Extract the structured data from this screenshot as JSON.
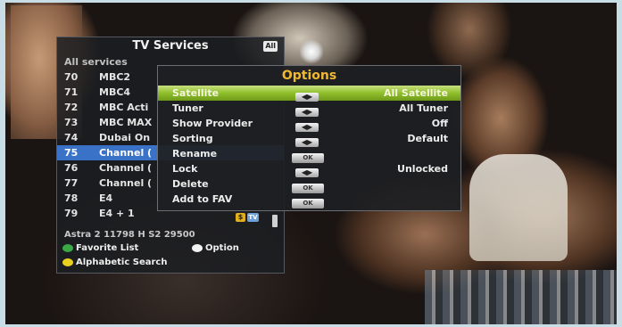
{
  "services": {
    "title": "TV Services",
    "all_badge": "All",
    "subtitle": "All services",
    "rows": [
      {
        "num": "70",
        "name": "MBC2"
      },
      {
        "num": "71",
        "name": "MBC4"
      },
      {
        "num": "72",
        "name": "MBC Acti"
      },
      {
        "num": "73",
        "name": "MBC MAX"
      },
      {
        "num": "74",
        "name": "Dubai On"
      },
      {
        "num": "75",
        "name": "Channel ("
      },
      {
        "num": "76",
        "name": "Channel ("
      },
      {
        "num": "77",
        "name": "Channel ("
      },
      {
        "num": "78",
        "name": "E4"
      },
      {
        "num": "79",
        "name": "E4 + 1"
      }
    ],
    "row_badges": {
      "s": "$",
      "tv": "TV"
    },
    "tp_info": "Astra 2 11798  H  S2 29500",
    "legend": {
      "green": "Favorite List",
      "white": "Option",
      "yellow": "Alphabetic Search"
    },
    "colors": {
      "selected": "#3a72c8",
      "green": "#3aa844",
      "yellow": "#e8d020"
    }
  },
  "options": {
    "title": "Options",
    "rows": [
      {
        "label": "Satellite",
        "control": "arrows",
        "value": "All Satellite"
      },
      {
        "label": "Tuner",
        "control": "arrows",
        "value": "All Tuner"
      },
      {
        "label": "Show Provider",
        "control": "arrows",
        "value": "Off"
      },
      {
        "label": "Sorting",
        "control": "arrows",
        "value": "Default"
      },
      {
        "label": "Rename",
        "control": "ok",
        "value": ""
      },
      {
        "label": "Lock",
        "control": "arrows",
        "value": "Unlocked"
      },
      {
        "label": "Delete",
        "control": "ok",
        "value": ""
      },
      {
        "label": "Add to FAV",
        "control": "ok",
        "value": ""
      }
    ],
    "arrows_glyph": "◀▶",
    "ok_label": "OK",
    "colors": {
      "title": "#f0b830",
      "selected": "#8fbf2a"
    }
  }
}
